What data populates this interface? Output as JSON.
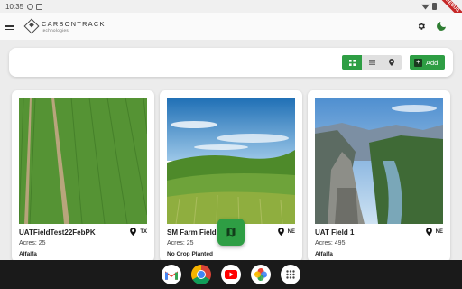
{
  "status_bar": {
    "time": "10:35"
  },
  "app": {
    "brand_name": "CARBONTRACK",
    "brand_sub": "technologies",
    "accent": "#2e9e44"
  },
  "toolbar": {
    "add_label": "Add"
  },
  "cards": [
    {
      "title": "UATFieldTest22FebPK",
      "location": "TX",
      "acres": "Acres: 25",
      "crop": "Alfalfa"
    },
    {
      "title": "SM Farm Field",
      "location": "NE",
      "acres": "Acres: 25",
      "crop": "No Crop Planted"
    },
    {
      "title": "UAT Field 1",
      "location": "NE",
      "acres": "Acres: 495",
      "crop": "Alfalfa"
    }
  ],
  "dock_apps": [
    "gmail-icon",
    "chrome-icon",
    "youtube-icon",
    "photos-icon",
    "app-drawer-icon"
  ]
}
